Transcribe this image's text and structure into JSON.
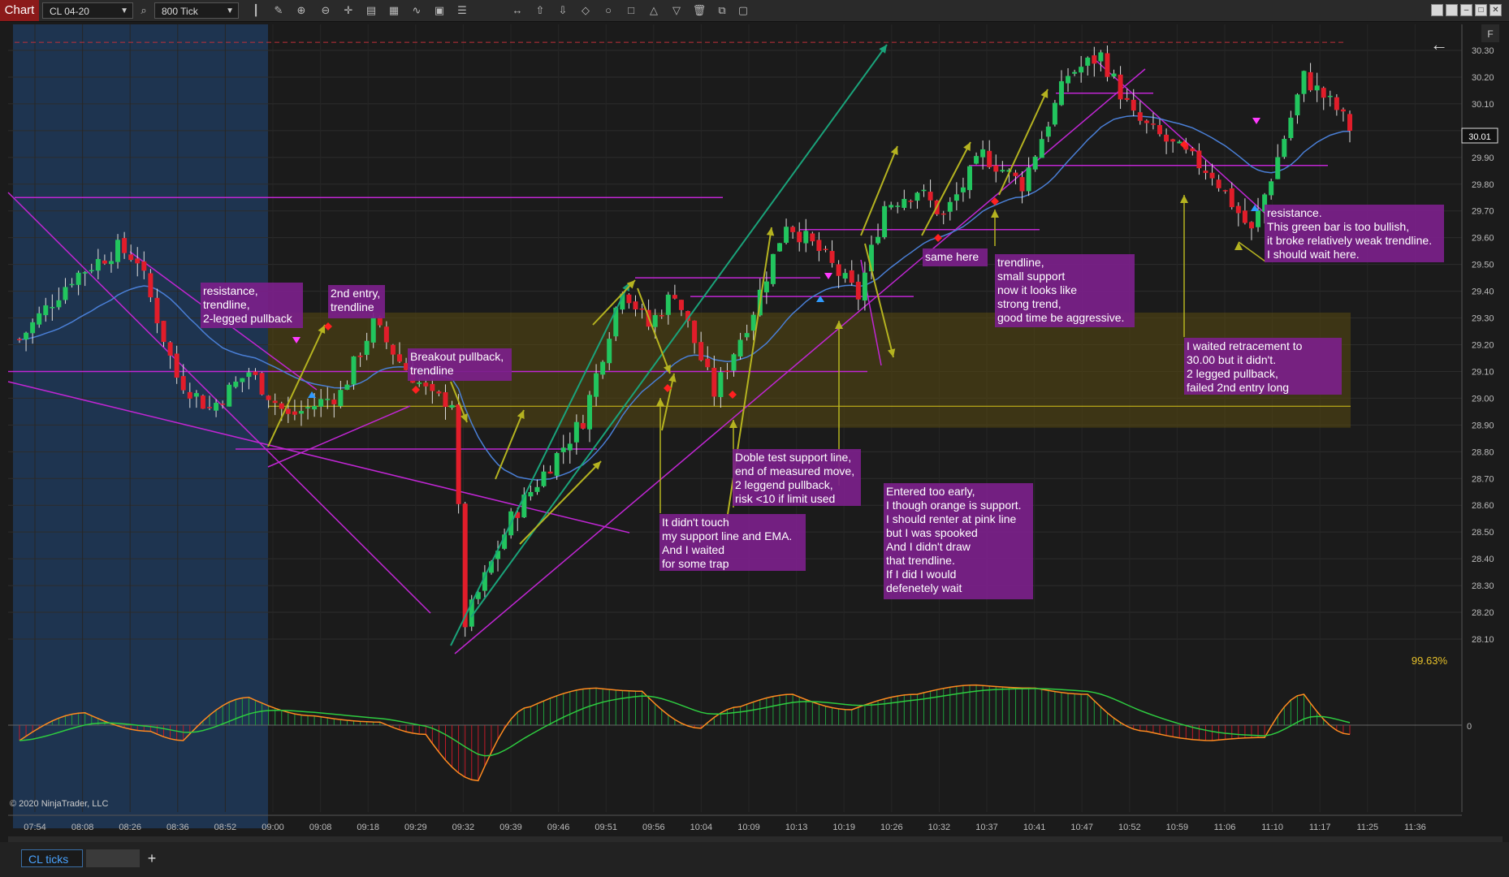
{
  "toolbar": {
    "chart_tab": "Chart",
    "instrument": "CL 04-20",
    "interval": "800 Tick"
  },
  "icons": [
    "bar-type-icon",
    "pencil-icon",
    "zoom-in-icon",
    "zoom-out-icon",
    "crosshair-icon",
    "properties-icon",
    "templates-icon",
    "strategy-icon",
    "indicators-icon",
    "list-icon",
    "line-tool-icon",
    "arrow-up-icon",
    "arrow-down-icon",
    "diamond-icon",
    "circle-icon",
    "square-icon",
    "triangle-up-icon",
    "triangle-down-icon",
    "trash-icon",
    "copy-icon"
  ],
  "colors": {
    "background": "#1b1b1b",
    "bull_candle": "#22c55e",
    "bear_candle": "#e11d2a",
    "ema": "#4a7fd6",
    "trendline": "#c026d3",
    "annotation_bg": "#7b1f8a",
    "zone_fill": "#5a4a10",
    "arrow_olive": "#b5b320",
    "arrow_teal": "#1aa37a",
    "session_shade": "#1e3450"
  },
  "price_axis": [
    "30.30",
    "30.20",
    "30.10",
    "30.00",
    "29.90",
    "29.80",
    "29.70",
    "29.60",
    "29.50",
    "29.40",
    "29.30",
    "29.20",
    "29.10",
    "29.00",
    "28.90",
    "28.80",
    "28.70",
    "28.60",
    "28.50",
    "28.40",
    "28.30",
    "28.20",
    "28.10"
  ],
  "current_price": "30.01",
  "indicator_zero": "0",
  "percent_label": "99.63%",
  "copyright": "© 2020 NinjaTrader, LLC",
  "panel_label_f": "F",
  "time_axis": [
    "07:54",
    "08:08",
    "08:26",
    "08:36",
    "08:52",
    "09:00",
    "09:08",
    "09:18",
    "09:29",
    "09:32",
    "09:39",
    "09:46",
    "09:51",
    "09:56",
    "10:04",
    "10:09",
    "10:13",
    "10:19",
    "10:26",
    "10:32",
    "10:37",
    "10:41",
    "10:47",
    "10:52",
    "10:59",
    "11:06",
    "11:10",
    "11:17",
    "11:25",
    "11:36"
  ],
  "bottom": {
    "tab_label": "CL ticks",
    "add_tab": "+"
  },
  "annotations": [
    [
      "resistance,",
      "trendline,",
      "2-legged pullback"
    ],
    [
      "2nd entry,",
      "trendline"
    ],
    [
      "Breakout pullback,",
      "trendline"
    ],
    [
      "It didn't touch",
      "my support line and EMA.",
      "And I waited",
      "for some trap"
    ],
    [
      "Doble test support line,",
      "end of measured move,",
      "2 leggend pullback,",
      "risk <10 if limit used"
    ],
    [
      "Entered too early,",
      "I though orange is support.",
      "I should renter at pink line",
      "but I was spooked",
      "And I didn't draw",
      "that trendline.",
      "If I did I would",
      "defenetely wait"
    ],
    [
      "same here"
    ],
    [
      "trendline,",
      "small support",
      "now it looks like",
      "strong trend,",
      "good time be aggressive."
    ],
    [
      "I waited retracement to",
      "30.00 but it didn't.",
      "2 legged pullback,",
      "failed 2nd entry long"
    ],
    [
      "resistance.",
      "This green bar is too bullish,",
      "it broke relatively weak trendline.",
      "I should wait here."
    ]
  ],
  "chart_data": {
    "type": "candlestick",
    "title": "",
    "instrument": "CL 04-20",
    "bar_type": "800 Tick",
    "y_range": [
      28.04,
      30.38
    ],
    "y_ticks": [
      28.1,
      28.2,
      28.3,
      28.4,
      28.5,
      28.6,
      28.7,
      28.8,
      28.9,
      29.0,
      29.1,
      29.2,
      29.3,
      29.4,
      29.5,
      29.6,
      29.7,
      29.8,
      29.9,
      30.0,
      30.1,
      30.2,
      30.3
    ],
    "current_price": 30.01,
    "support_resistance_lines": [
      29.75,
      29.1,
      28.97,
      28.81,
      29.45,
      29.38,
      29.63,
      29.87,
      30.14,
      30.33
    ],
    "zone": [
      28.89,
      29.32
    ],
    "anchors": [
      {
        "i": 0,
        "p": 29.22
      },
      {
        "i": 8,
        "p": 29.45
      },
      {
        "i": 15,
        "p": 29.56
      },
      {
        "i": 18,
        "p": 29.52
      },
      {
        "i": 24,
        "p": 29.08
      },
      {
        "i": 29,
        "p": 28.96
      },
      {
        "i": 35,
        "p": 29.1
      },
      {
        "i": 41,
        "p": 28.93
      },
      {
        "i": 49,
        "p": 29.02
      },
      {
        "i": 54,
        "p": 29.28
      },
      {
        "i": 58,
        "p": 29.14
      },
      {
        "i": 63,
        "p": 29.0
      },
      {
        "i": 66,
        "p": 28.99
      },
      {
        "i": 68,
        "p": 28.16
      },
      {
        "i": 75,
        "p": 28.55
      },
      {
        "i": 80,
        "p": 28.72
      },
      {
        "i": 86,
        "p": 28.92
      },
      {
        "i": 92,
        "p": 29.42
      },
      {
        "i": 96,
        "p": 29.27
      },
      {
        "i": 100,
        "p": 29.4
      },
      {
        "i": 106,
        "p": 29.02
      },
      {
        "i": 112,
        "p": 29.33
      },
      {
        "i": 117,
        "p": 29.66
      },
      {
        "i": 122,
        "p": 29.55
      },
      {
        "i": 128,
        "p": 29.38
      },
      {
        "i": 132,
        "p": 29.72
      },
      {
        "i": 137,
        "p": 29.78
      },
      {
        "i": 141,
        "p": 29.68
      },
      {
        "i": 147,
        "p": 29.91
      },
      {
        "i": 153,
        "p": 29.8
      },
      {
        "i": 160,
        "p": 30.21
      },
      {
        "i": 165,
        "p": 30.28
      },
      {
        "i": 170,
        "p": 30.05
      },
      {
        "i": 175,
        "p": 29.96
      },
      {
        "i": 182,
        "p": 29.84
      },
      {
        "i": 188,
        "p": 29.62
      },
      {
        "i": 192,
        "p": 29.9
      },
      {
        "i": 196,
        "p": 30.2
      },
      {
        "i": 201,
        "p": 30.08
      },
      {
        "i": 203,
        "p": 30.01
      }
    ],
    "bar_count": 204,
    "indicator": {
      "type": "macd",
      "zero_line": 0,
      "anchors": [
        {
          "i": 0,
          "m": -0.5
        },
        {
          "i": 10,
          "m": 0.4
        },
        {
          "i": 20,
          "m": -0.2
        },
        {
          "i": 25,
          "m": -0.5
        },
        {
          "i": 35,
          "m": 0.9
        },
        {
          "i": 45,
          "m": 0.3
        },
        {
          "i": 55,
          "m": 0.1
        },
        {
          "i": 62,
          "m": -0.3
        },
        {
          "i": 70,
          "m": -1.8
        },
        {
          "i": 78,
          "m": 0.6
        },
        {
          "i": 88,
          "m": 1.2
        },
        {
          "i": 95,
          "m": 1.1
        },
        {
          "i": 104,
          "m": -0.1
        },
        {
          "i": 110,
          "m": 0.6
        },
        {
          "i": 118,
          "m": 1.0
        },
        {
          "i": 127,
          "m": 0.5
        },
        {
          "i": 137,
          "m": 1.0
        },
        {
          "i": 146,
          "m": 1.3
        },
        {
          "i": 155,
          "m": 1.2
        },
        {
          "i": 163,
          "m": 1.0
        },
        {
          "i": 172,
          "m": -0.2
        },
        {
          "i": 182,
          "m": -0.5
        },
        {
          "i": 190,
          "m": -0.4
        },
        {
          "i": 196,
          "m": 1.0
        },
        {
          "i": 203,
          "m": -0.3
        }
      ]
    }
  }
}
